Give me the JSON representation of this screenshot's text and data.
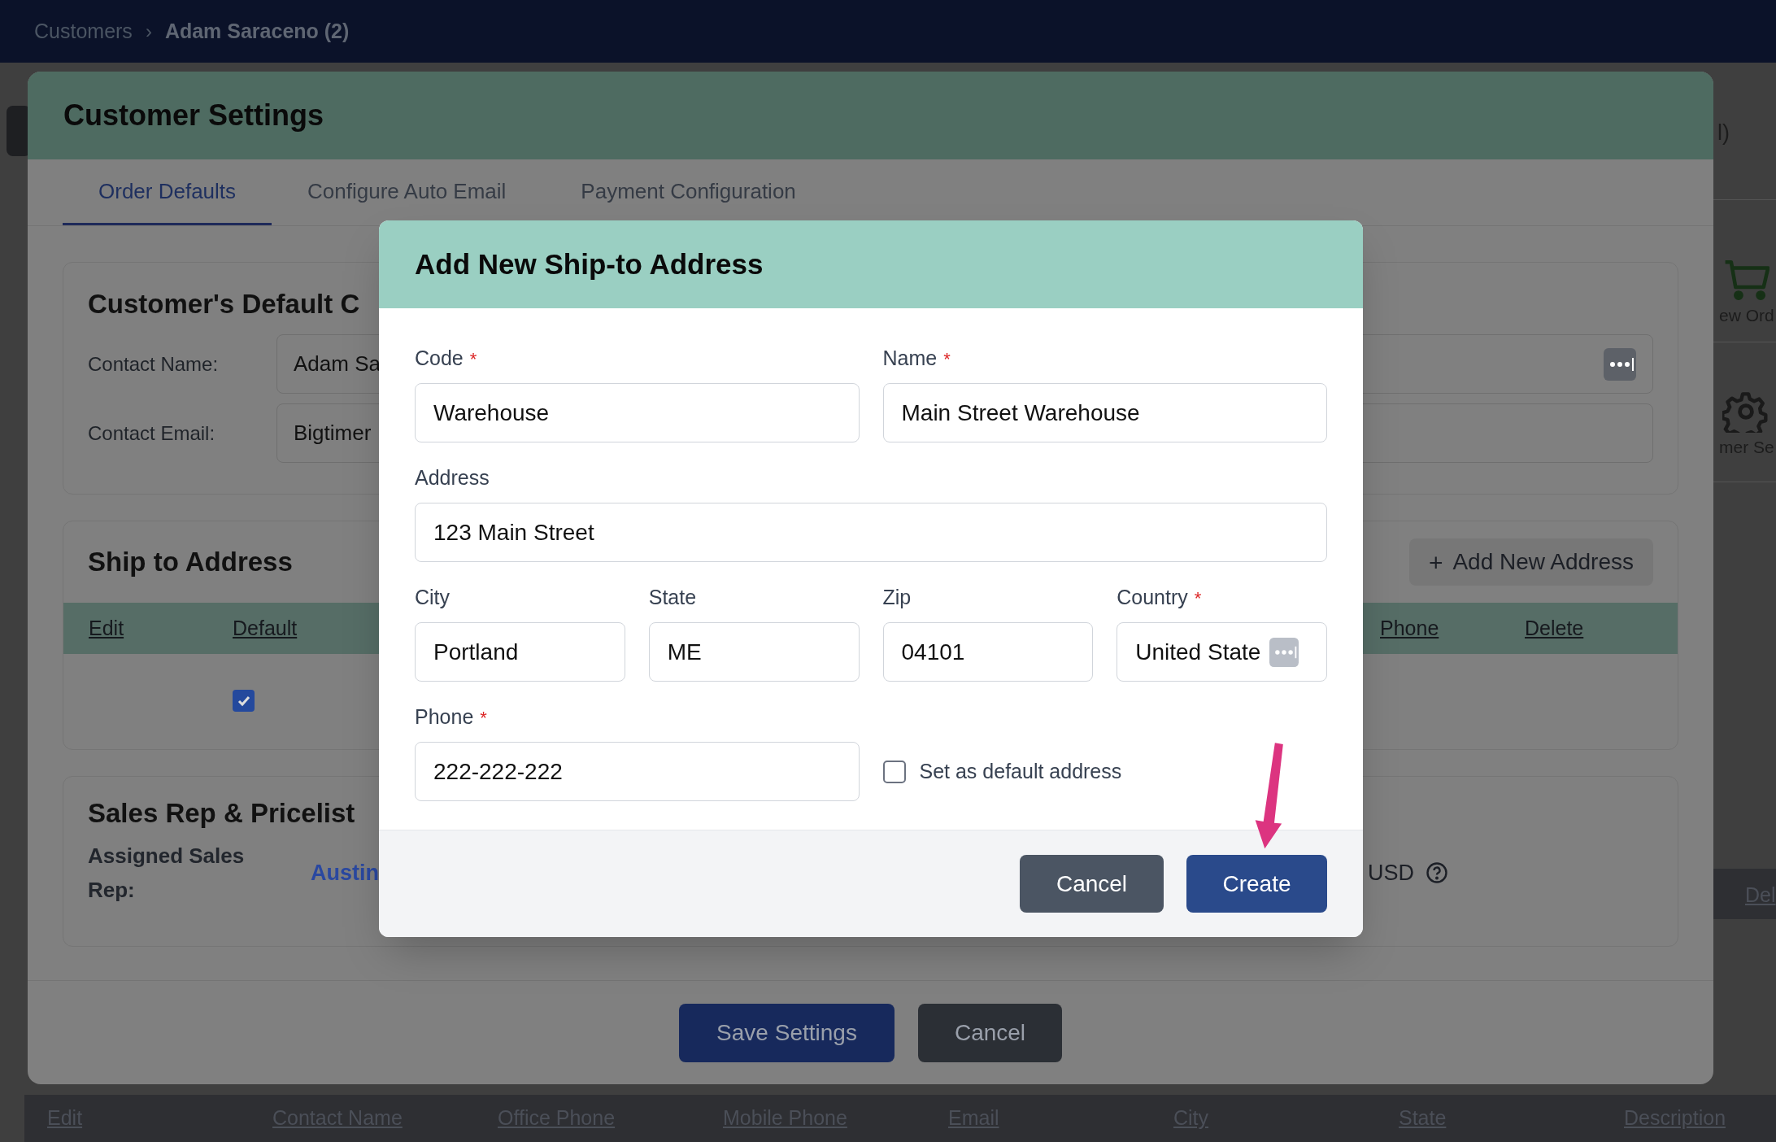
{
  "breadcrumb": {
    "items": [
      "Customers",
      "Adam Saraceno (2)"
    ],
    "separator": "›"
  },
  "background": {
    "header_fragment": "l)",
    "side_actions": [
      {
        "kind": "cart",
        "label": "ew Ord"
      },
      {
        "kind": "gear",
        "label": "mer Se"
      }
    ],
    "row_fragment": "Del",
    "table_columns": [
      "Edit",
      "Contact Name",
      "Office Phone",
      "Mobile Phone",
      "Email",
      "City",
      "State",
      "Description"
    ]
  },
  "settings": {
    "title": "Customer Settings",
    "tabs": [
      {
        "label": "Order Defaults",
        "selected": true
      },
      {
        "label": "Configure Auto Email",
        "selected": false
      },
      {
        "label": "Payment Configuration",
        "selected": false
      }
    ],
    "default_contact": {
      "title": "Customer's Default C",
      "fields": [
        {
          "label": "Contact Name:",
          "value": "Adam Sa",
          "picker": true
        },
        {
          "label": "Contact Email:",
          "value": "Bigtimer",
          "picker": false
        }
      ]
    },
    "ship_to": {
      "title": "Ship to Address",
      "add_button": {
        "icon": "+",
        "label": "Add New Address"
      },
      "columns": [
        "Edit",
        "Default",
        "Phone",
        "Delete"
      ],
      "rows": [
        {
          "default": true
        }
      ]
    },
    "sales_rep": {
      "title": "Sales Rep & Pricelist",
      "label": "Assigned Sales Rep:",
      "rep": "Austin",
      "currency": "USD"
    },
    "buttons": [
      {
        "label": "Save Settings",
        "kind": "primary"
      },
      {
        "label": "Cancel",
        "kind": "secondary"
      }
    ]
  },
  "dialog": {
    "title": "Add New Ship-to Address",
    "required_mark": "*",
    "rows": [
      [
        {
          "kind": "text",
          "label": "Code",
          "required": true,
          "value": "Warehouse"
        },
        {
          "kind": "text",
          "label": "Name",
          "required": true,
          "value": "Main Street Warehouse"
        }
      ],
      [
        {
          "kind": "text",
          "label": "Address",
          "required": false,
          "value": "123 Main Street"
        }
      ],
      [
        {
          "kind": "text",
          "label": "City",
          "required": false,
          "value": "Portland"
        },
        {
          "kind": "text",
          "label": "State",
          "required": false,
          "value": "ME"
        },
        {
          "kind": "text",
          "label": "Zip",
          "required": false,
          "value": "04101"
        },
        {
          "kind": "select",
          "label": "Country",
          "required": true,
          "value": "United State"
        }
      ],
      [
        {
          "kind": "text",
          "label": "Phone",
          "required": true,
          "value": "222-222-222"
        },
        {
          "kind": "checkbox",
          "label": "Set as default address",
          "checked": false
        }
      ]
    ],
    "buttons": [
      {
        "label": "Cancel",
        "kind": "secondary"
      },
      {
        "label": "Create",
        "kind": "primary"
      }
    ]
  }
}
